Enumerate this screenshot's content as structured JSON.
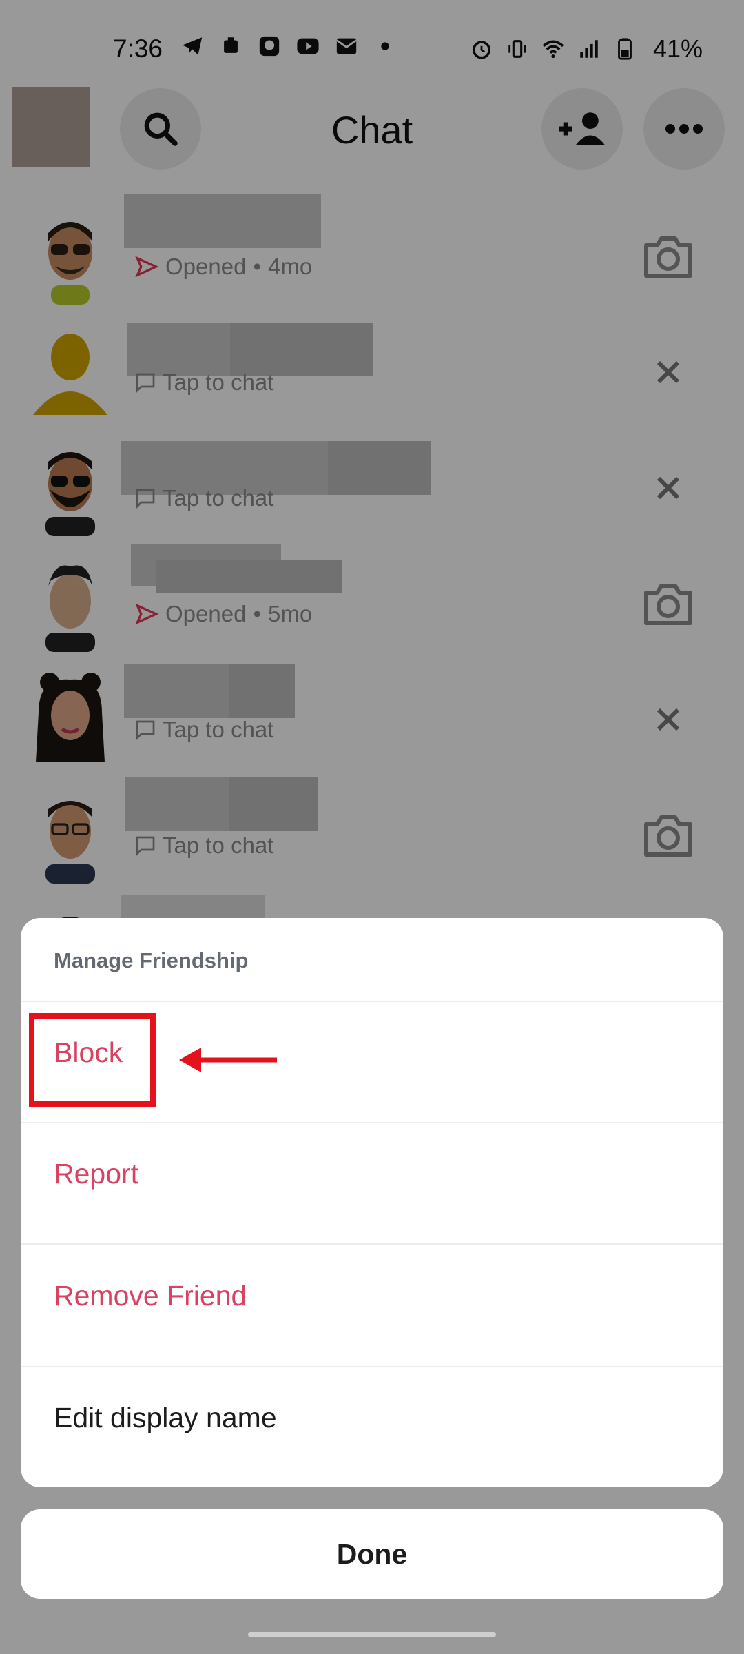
{
  "status_bar": {
    "time": "7:36",
    "left_icons": [
      "telegram-icon",
      "notification-icon",
      "messenger-icon",
      "youtube-icon",
      "mail-icon",
      "dot-icon"
    ],
    "right_icons": [
      "alarm-icon",
      "vibrate-icon",
      "wifi-icon",
      "signal-icon",
      "battery-icon"
    ],
    "battery": "41%"
  },
  "header": {
    "title": "Chat",
    "buttons": [
      "search-icon",
      "add-friend-icon",
      "more-icon"
    ]
  },
  "chats": [
    {
      "status": "Opened",
      "age": "4mo",
      "status_icon": "sent-arrow-icon",
      "action_icon": "camera-icon"
    },
    {
      "status": "Tap to chat",
      "status_icon": "chat-bubble-icon",
      "action_icon": "close-icon"
    },
    {
      "status": "Tap to chat",
      "status_icon": "chat-bubble-icon",
      "action_icon": "close-icon"
    },
    {
      "status": "Opened",
      "age": "5mo",
      "status_icon": "sent-arrow-icon",
      "action_icon": "camera-icon"
    },
    {
      "status": "Tap to chat",
      "status_icon": "chat-bubble-icon",
      "action_icon": "close-icon"
    },
    {
      "status": "Tap to chat",
      "status_icon": "chat-bubble-icon",
      "action_icon": "camera-icon"
    }
  ],
  "sheet": {
    "title": "Manage Friendship",
    "options": [
      "Block",
      "Report",
      "Remove Friend",
      "Edit display name"
    ]
  },
  "done_label": "Done",
  "colors": {
    "danger": "#d94262",
    "annotation": "#e5121d",
    "opened_arrow": "#e13a5a"
  }
}
